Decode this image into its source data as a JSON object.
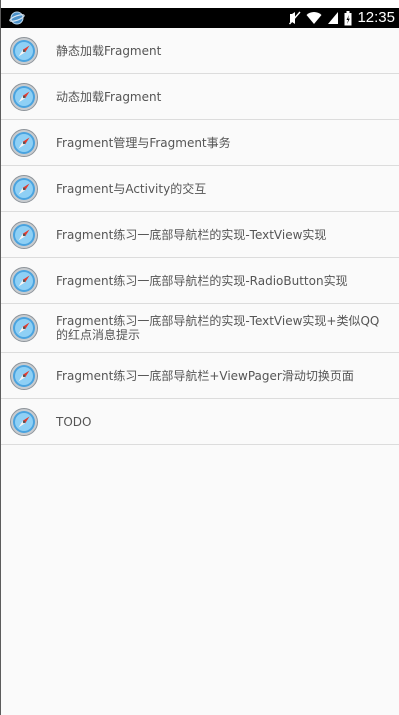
{
  "status_bar": {
    "time": "12:35",
    "left_icon": "globe-icon",
    "right_icons": [
      "mute-icon",
      "wifi-icon",
      "signal-icon",
      "battery-icon"
    ]
  },
  "list": {
    "items": [
      {
        "label": "静态加载Fragment",
        "icon": "compass-icon"
      },
      {
        "label": "动态加载Fragment",
        "icon": "compass-icon"
      },
      {
        "label": "Fragment管理与Fragment事务",
        "icon": "compass-icon"
      },
      {
        "label": "Fragment与Activity的交互",
        "icon": "compass-icon"
      },
      {
        "label": "Fragment练习一底部导航栏的实现-TextView实现",
        "icon": "compass-icon"
      },
      {
        "label": "Fragment练习一底部导航栏的实现-RadioButton实现",
        "icon": "compass-icon"
      },
      {
        "label": "Fragment练习一底部导航栏的实现-TextView实现+类似QQ的红点消息提示",
        "icon": "compass-icon"
      },
      {
        "label": "Fragment练习一底部导航栏+ViewPager滑动切换页面",
        "icon": "compass-icon"
      },
      {
        "label": "TODO",
        "icon": "compass-icon"
      }
    ]
  }
}
